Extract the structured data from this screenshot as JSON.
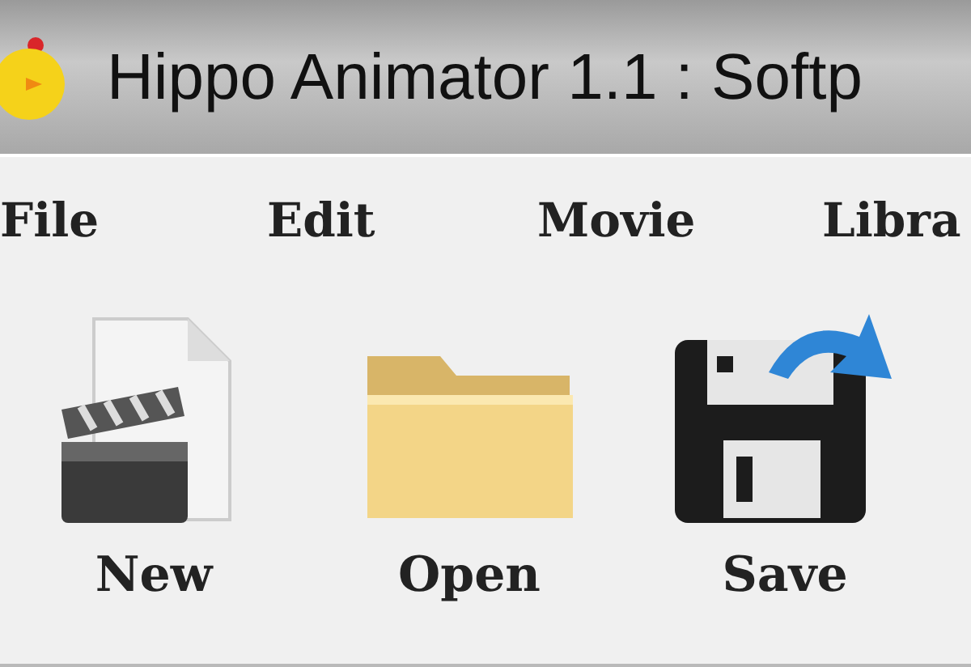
{
  "window": {
    "title": "Hippo Animator 1.1 : Softp"
  },
  "menu": [
    {
      "label": "File"
    },
    {
      "label": "Edit"
    },
    {
      "label": "Movie"
    },
    {
      "label": "Libra"
    }
  ],
  "toolbar": [
    {
      "label": "New",
      "kind": "new"
    },
    {
      "label": "Open",
      "kind": "open"
    },
    {
      "label": "Save",
      "kind": "save"
    }
  ]
}
